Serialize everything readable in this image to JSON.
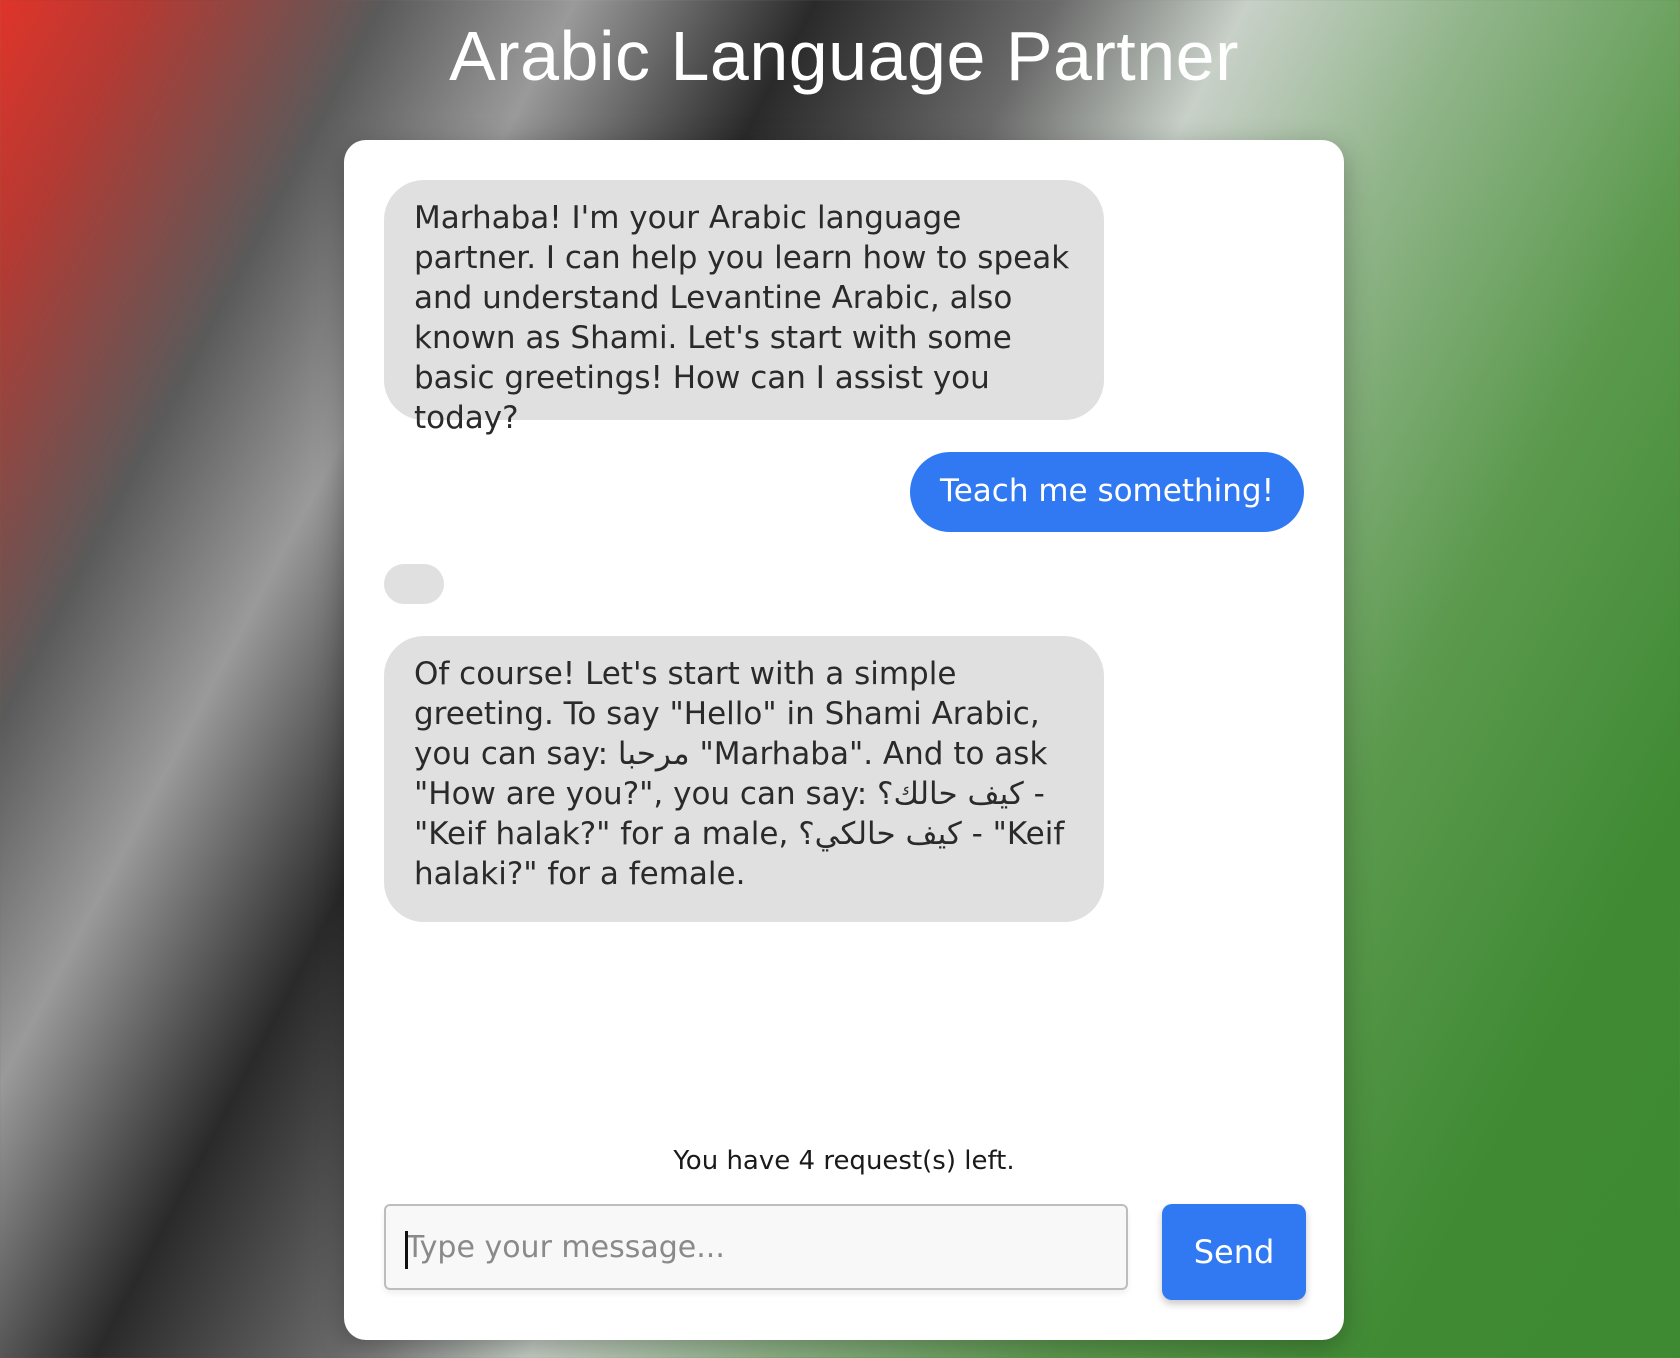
{
  "header": {
    "title": "Arabic Language Partner"
  },
  "chat": {
    "messages": [
      {
        "role": "assistant",
        "text": "Marhaba! I'm your Arabic language partner. I can help you learn how to speak and understand Levantine Arabic, also known as Shami. Let's start with some basic greetings! How can I assist you today?"
      },
      {
        "role": "user",
        "text": "Teach me something!"
      },
      {
        "role": "assistant",
        "text": "Of course! Let's start with a simple greeting. To say \"Hello\" in Shami Arabic, you can say: مرحبا \"Marhaba\". And to ask \"How are you?\", you can say: كيف حالك؟ - \"Keif halak?\" for a male, كيف حالكي؟ - \"Keif halaki?\" for a female."
      }
    ]
  },
  "footer": {
    "requests_left": "You have 4 request(s) left.",
    "input_placeholder": "Type your message...",
    "send_label": "Send"
  },
  "colors": {
    "accent": "#3079f2",
    "bot_bubble": "#e0e0e0",
    "card": "#ffffff"
  }
}
